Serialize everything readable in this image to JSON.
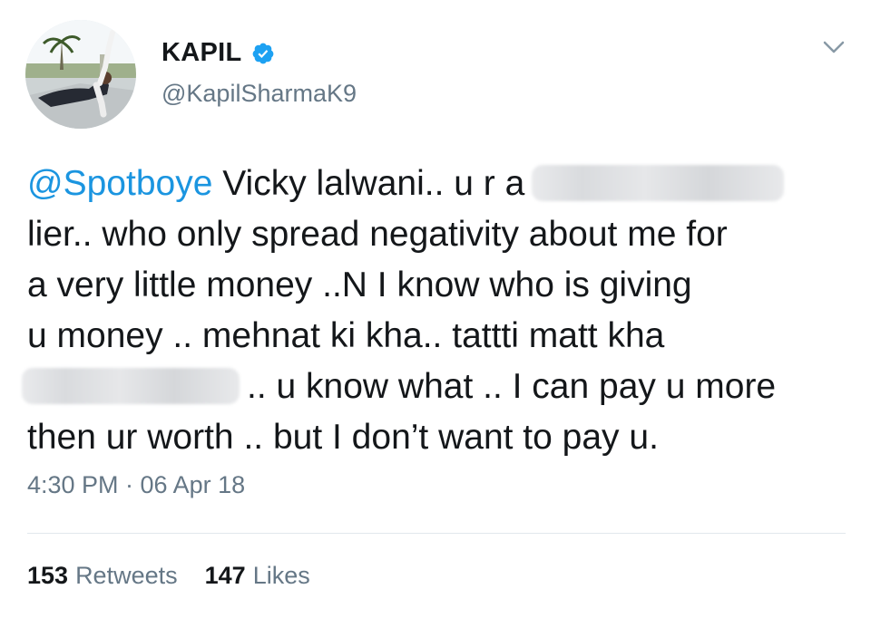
{
  "user": {
    "display_name": "KAPIL",
    "handle": "@KapilSharmaK9",
    "verified": true
  },
  "icons": {
    "verified": "verified-badge-icon",
    "menu": "chevron-down-icon"
  },
  "tweet": {
    "mention": "@Spotboye",
    "line1_text": " Vicky lalwani.. u r a",
    "line2": "lier.. who only spread negativity about me for",
    "line3": "a very little money ..N I know who is giving",
    "line4": "u money .. mehnat ki kha.. tattti matt kha",
    "line5_text": ".. u know what ..  I can pay u more",
    "line6": "then ur worth .. but I don’t want to pay u."
  },
  "meta": {
    "timestamp": "4:30 PM · 06 Apr 18"
  },
  "stats": {
    "retweets_count": "153",
    "retweets_label": "Retweets",
    "likes_count": "147",
    "likes_label": "Likes"
  },
  "colors": {
    "link": "#1b95e0",
    "secondary_text": "#657786",
    "primary_text": "#14171a",
    "verified": "#1da1f2"
  }
}
